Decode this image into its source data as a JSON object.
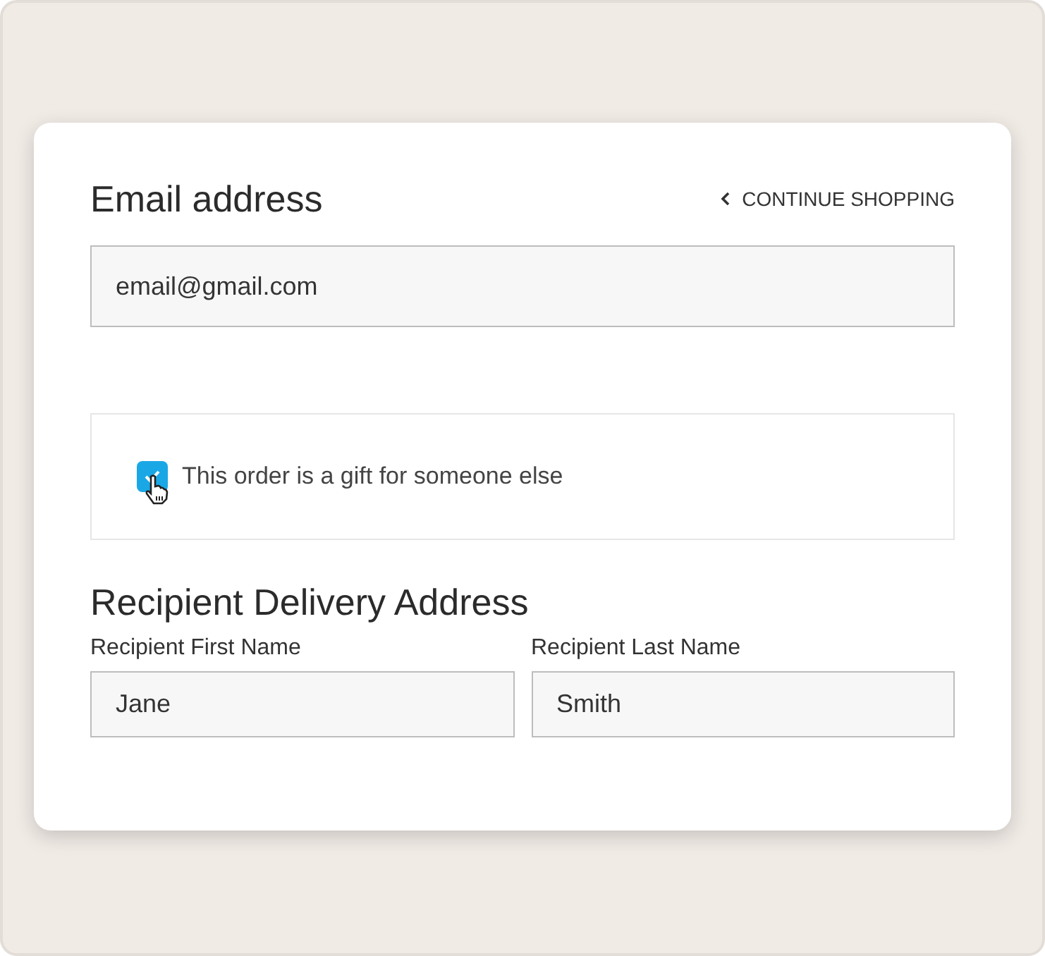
{
  "email": {
    "title": "Email address",
    "value": "email@gmail.com"
  },
  "continue_link": {
    "label": "CONTINUE SHOPPING"
  },
  "gift_option": {
    "label": "This order is a gift for someone else",
    "checked": true
  },
  "recipient": {
    "title": "Recipient Delivery Address",
    "fields": [
      {
        "label": "Recipient First Name",
        "value": "Jane"
      },
      {
        "label": "Recipient Last Name",
        "value": "Smith"
      }
    ]
  }
}
